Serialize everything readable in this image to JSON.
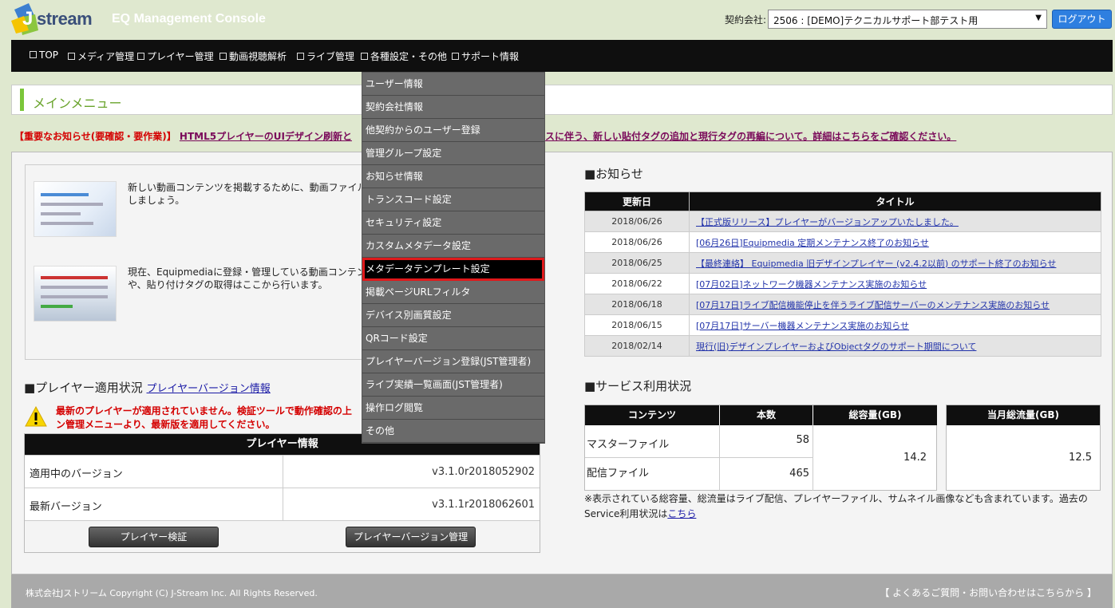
{
  "header": {
    "logo_text": "stream",
    "logo_letter": "J",
    "console_title": "EQ Management Console",
    "contract_label": "契約会社:",
    "contract_value": "2506 : [DEMO]テクニカルサポート部テスト用",
    "logout_label": "ログアウト",
    "colors": {
      "logout": "#2e7fe0",
      "nav": "#0f0f0f",
      "accent": "#7bc63a"
    }
  },
  "nav": {
    "items": [
      {
        "label": "TOP"
      },
      {
        "label": "メディア管理"
      },
      {
        "label": "プレイヤー管理"
      },
      {
        "label": "動画視聴解析"
      },
      {
        "label": "ライブ管理"
      },
      {
        "label": "各種設定・その他"
      },
      {
        "label": "サポート情報"
      }
    ]
  },
  "dropdown": {
    "items": [
      {
        "label": "ユーザー情報"
      },
      {
        "label": "契約会社情報"
      },
      {
        "label": "他契約からのユーザー登録"
      },
      {
        "label": "管理グループ設定"
      },
      {
        "label": "お知らせ情報"
      },
      {
        "label": "トランスコード設定"
      },
      {
        "label": "セキュリティ設定"
      },
      {
        "label": "カスタムメタデータ設定"
      },
      {
        "label": "メタデータテンプレート設定"
      },
      {
        "label": "掲載ページURLフィルタ"
      },
      {
        "label": "デバイス別画質設定"
      },
      {
        "label": "QRコード設定"
      },
      {
        "label": "プレイヤーバージョン登録(JST管理者)"
      },
      {
        "label": "ライブ実績一覧画面(JST管理者)"
      },
      {
        "label": "操作ログ閲覧"
      },
      {
        "label": "その他"
      }
    ],
    "active_index": 8
  },
  "main_menu": {
    "title": "メインメニュー"
  },
  "notice": {
    "tag": "【重要なお知らせ(要確認・要作業)】",
    "link_start": "HTML5プレイヤーのUIデザイン刷新と",
    "link_end": "スに伴う、新しい貼付タグの追加と現行タグの再編について。詳細はこちらをご確認ください。"
  },
  "left_panel": {
    "item1_text_line1": "新しい動画コンテンツを掲載するために、動画ファイル",
    "item1_text_line2": "しましょう。",
    "item2_text_line1": "現在、Equipmediaに登録・管理している動画コンテンツ",
    "item2_text_line2": "や、貼り付けタグの取得はここから行います。"
  },
  "player_status": {
    "title": "■プレイヤー適用状況",
    "link": "プレイヤーバージョン情報",
    "warning_line1": "最新のプレイヤーが適用されていません。検証ツールで動作確認の上",
    "warning_line2": "ン管理メニューより、最新版を適用してください。",
    "table_header": "プレイヤー情報",
    "rows": [
      {
        "label": "適用中のバージョン",
        "value": "v3.1.0r2018052902"
      },
      {
        "label": "最新バージョン",
        "value": "v3.1.1r2018062601"
      }
    ],
    "verify_button": "プレイヤー検証",
    "manage_button": "プレイヤーバージョン管理"
  },
  "news": {
    "title": "■お知らせ",
    "col_date": "更新日",
    "col_title": "タイトル",
    "rows": [
      {
        "date": "2018/06/26",
        "title": "【正式版リリース】プレイヤーがバージョンアップいたしました。"
      },
      {
        "date": "2018/06/26",
        "title": "[06月26日]Equipmedia 定期メンテナンス終了のお知らせ"
      },
      {
        "date": "2018/06/25",
        "title": "【最終連絡】 Equipmedia 旧デザインプレイヤー (v2.4.2以前) のサポート終了のお知らせ"
      },
      {
        "date": "2018/06/22",
        "title": "[07月02日]ネットワーク機器メンテナンス実施のお知らせ"
      },
      {
        "date": "2018/06/18",
        "title": "[07月17日]ライブ配信機能停止を伴うライブ配信サーバーのメンテナンス実施のお知らせ"
      },
      {
        "date": "2018/06/15",
        "title": "[07月17日]サーバー機器メンテナンス実施のお知らせ"
      },
      {
        "date": "2018/02/14",
        "title": "現行(旧)デザインプレイヤーおよびObjectタグのサポート期間について"
      }
    ]
  },
  "service": {
    "title": "■サービス利用状況",
    "col_content": "コンテンツ",
    "col_count": "本数",
    "col_total": "総容量(GB)",
    "col_monthly": "当月総流量(GB)",
    "master_label": "マスターファイル",
    "master_count": "58",
    "delivery_label": "配信ファイル",
    "delivery_count": "465",
    "total_gb": "14.2",
    "monthly_gb": "12.5",
    "note": "※表示されている総容量、総流量はライブ配信、プレイヤーファイル、サムネイル画像なども含まれています。過去のService利用状況は",
    "note_link": "こちら"
  },
  "footer": {
    "copyright": "株式会社Jストリーム Copyright (C) J-Stream Inc. All Rights Reserved.",
    "faq": "【 よくあるご質問・お問い合わせはこちらから 】"
  }
}
